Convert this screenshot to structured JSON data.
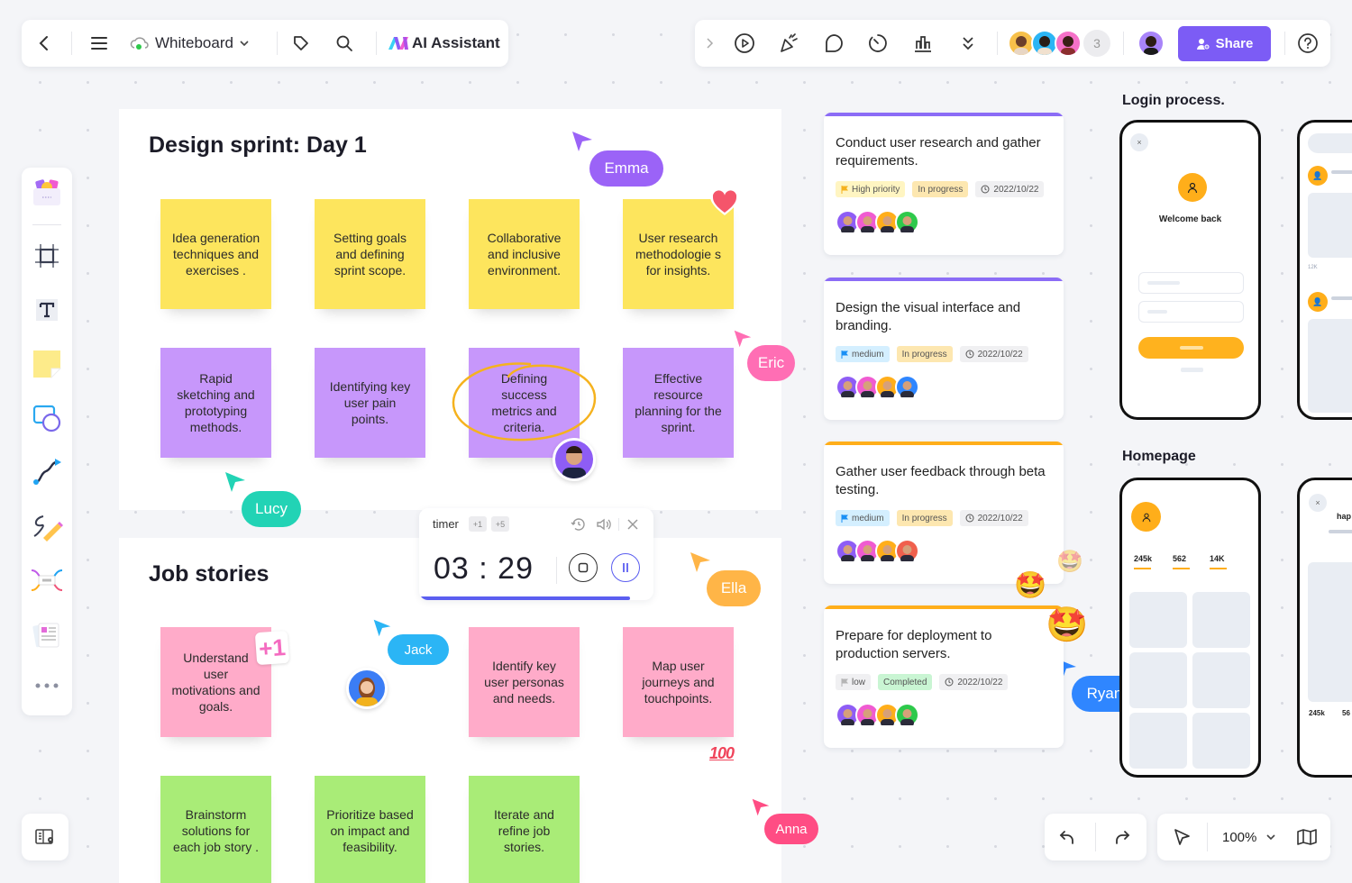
{
  "topbar_left": {
    "back_icon": "chevron-left-icon",
    "menu_icon": "hamburger-icon",
    "cloud_icon": "cloud-synced-icon",
    "doc_title": "Whiteboard",
    "tag_icon": "tag-icon",
    "search_icon": "search-icon",
    "ai_label": "AI Assistant"
  },
  "topbar_right": {
    "icons": [
      "chevron-right-icon",
      "play-icon",
      "celebrate-icon",
      "comment-icon",
      "timer-icon",
      "chart-icon",
      "more-down-icon"
    ],
    "collaborators_extra_count": "3",
    "share_label": "Share",
    "help_icon": "help-icon"
  },
  "toolbar": {
    "tools": [
      "templates",
      "frame",
      "text",
      "sticky-note",
      "shapes",
      "connector",
      "pen",
      "mind-map",
      "card"
    ],
    "more_icon": "more-icon"
  },
  "frames": {
    "design_sprint": {
      "title": "Design sprint: Day 1",
      "yellow_notes": [
        "Idea generation techniques and exercises .",
        "Setting goals and defining sprint scope.",
        "Collaborative and inclusive environment.",
        "User research methodologie s for insights."
      ],
      "purple_notes": [
        "Rapid sketching and prototyping methods.",
        "Identifying key user pain points.",
        "Defining success metrics and criteria.",
        "Effective resource planning for the sprint."
      ]
    },
    "job_stories": {
      "title": "Job stories",
      "pink_notes": [
        "Understand user motivations and goals.",
        "Identify key user personas and needs.",
        "Map user journeys and touchpoints."
      ],
      "green_notes": [
        "Brainstorm solutions for each job story .",
        "Prioritize based on impact and feasibility.",
        "Iterate and refine job stories."
      ]
    }
  },
  "stickers": {
    "plus_one": "+1",
    "hundred": "100"
  },
  "cursors": [
    {
      "name": "Emma",
      "color": "#9b63f7"
    },
    {
      "name": "Eric",
      "color": "#ff6eb4"
    },
    {
      "name": "Lucy",
      "color": "#22d3b5"
    },
    {
      "name": "Jack",
      "color": "#2bb5f5"
    },
    {
      "name": "Ella",
      "color": "#ffb547"
    },
    {
      "name": "Ryan",
      "color": "#2f86ff"
    },
    {
      "name": "Anna",
      "color": "#ff4d84"
    }
  ],
  "timer": {
    "label": "timer",
    "add_one": "+1",
    "add_five": "+5",
    "time": "03 : 29",
    "progress": 0.9
  },
  "tasks": [
    {
      "title": "Conduct user research and gather requirements.",
      "priority": "High priority",
      "status": "In progress",
      "date": "2022/10/22",
      "accent": "#8b6cf6"
    },
    {
      "title": "Design the visual interface and branding.",
      "priority": "medium",
      "status": "In progress",
      "date": "2022/10/22",
      "accent": "#8b6cf6"
    },
    {
      "title": "Gather user feedback through beta testing.",
      "priority": "medium",
      "status": "In progress",
      "date": "2022/10/22",
      "accent": "#ffae1a"
    },
    {
      "title": "Prepare for deployment to production servers.",
      "priority": "low",
      "status": "Completed",
      "date": "2022/10/22",
      "accent": "#ffae1a"
    }
  ],
  "wireframes": {
    "login_title": "Login process.",
    "welcome_text": "Welcome back",
    "like_count": "12K",
    "homepage_title": "Homepage",
    "stats": [
      "245k",
      "562",
      "14K"
    ],
    "second_stats": [
      "245k",
      "56"
    ],
    "second_title_partial": "hap"
  },
  "bottom": {
    "zoom_level": "100%"
  },
  "colors": {
    "brand": "#7c5cf5",
    "timer_progress": "#5b5ef0",
    "highlight_circle": "#f5b21e"
  }
}
